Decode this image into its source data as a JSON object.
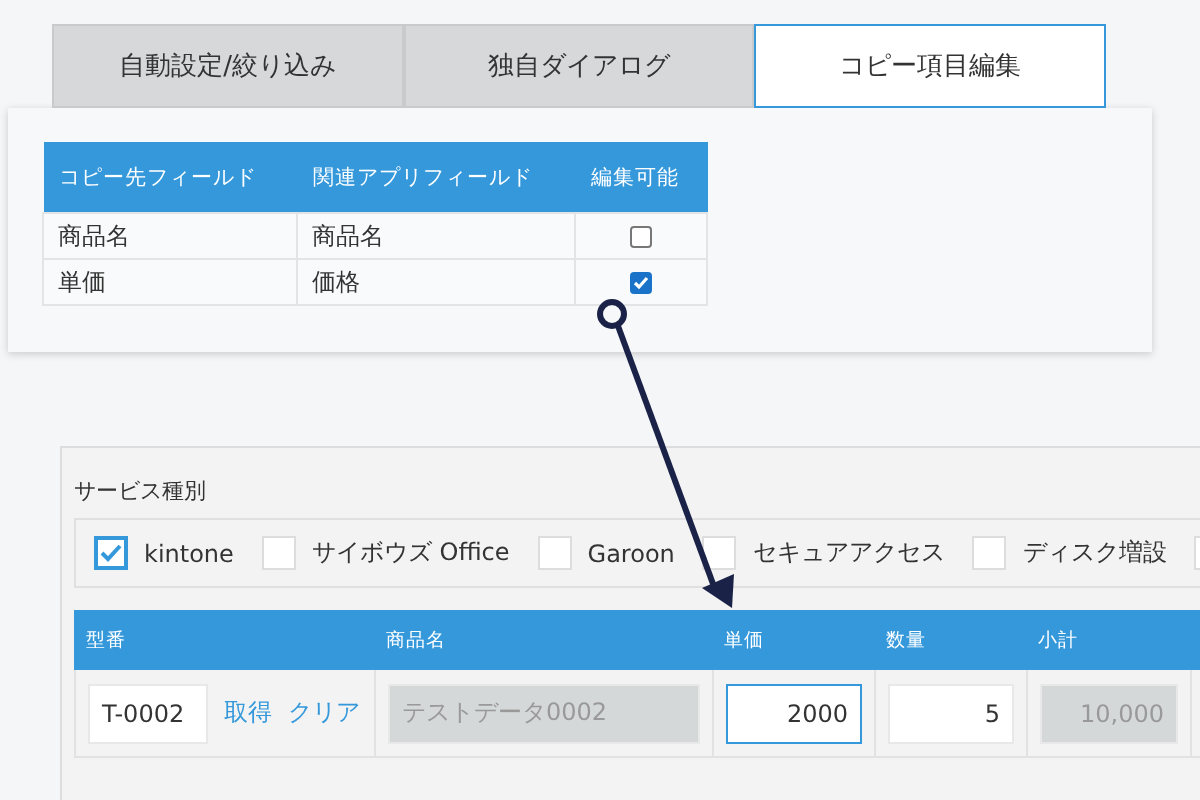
{
  "tabs": [
    {
      "label": "自動設定/絞り込み",
      "selected": false
    },
    {
      "label": "独自ダイアログ",
      "selected": false
    },
    {
      "label": "コピー項目編集",
      "selected": true
    }
  ],
  "copy_table": {
    "columns": [
      "コピー先フィールド",
      "関連アプリフィールド",
      "編集可能"
    ],
    "rows": [
      {
        "target": "商品名",
        "source": "商品名",
        "editable": false
      },
      {
        "target": "単価",
        "source": "価格",
        "editable": true
      }
    ]
  },
  "service": {
    "label": "サービス種別",
    "options": [
      {
        "label": "kintone",
        "checked": true
      },
      {
        "label": "サイボウズ Office",
        "checked": false
      },
      {
        "label": "Garoon",
        "checked": false
      },
      {
        "label": "セキュアアクセス",
        "checked": false
      },
      {
        "label": "ディスク増設",
        "checked": false
      },
      {
        "checked": false
      }
    ]
  },
  "order_table": {
    "columns": [
      "型番",
      "商品名",
      "単価",
      "数量",
      "小計"
    ],
    "row": {
      "model": "T-0002",
      "fetch": "取得",
      "clear": "クリア",
      "product": "テストデータ0002",
      "price": "2000",
      "quantity": "5",
      "subtotal": "10,000"
    }
  }
}
